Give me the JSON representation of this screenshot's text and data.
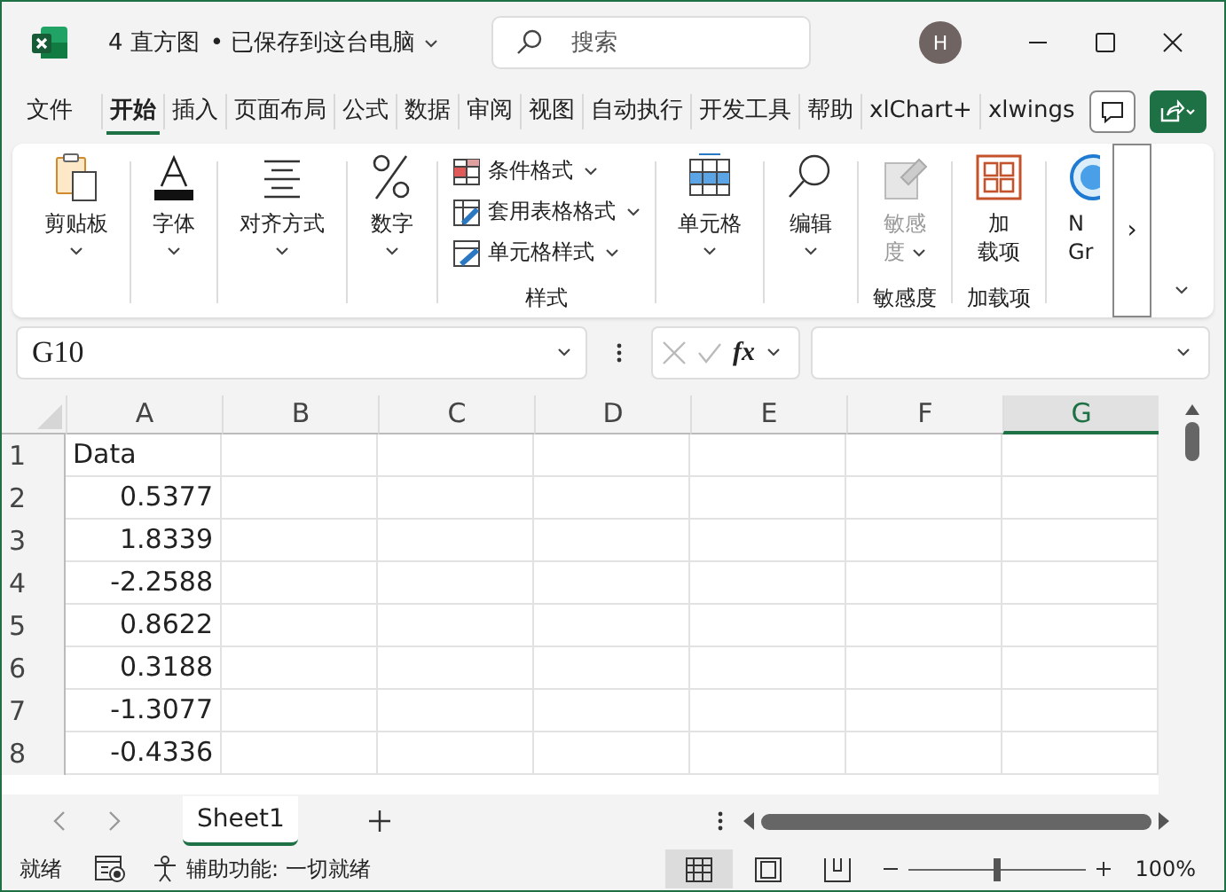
{
  "window": {
    "title": "4 直方图",
    "save_state": "• 已保存到这台电脑",
    "search": {
      "placeholder": "搜索"
    },
    "avatar": "H"
  },
  "tabs": [
    {
      "label": "文件",
      "selected": false
    },
    {
      "label": "开始",
      "selected": true
    },
    {
      "label": "插入",
      "selected": false
    },
    {
      "label": "页面布局",
      "selected": false
    },
    {
      "label": "公式",
      "selected": false
    },
    {
      "label": "数据",
      "selected": false
    },
    {
      "label": "审阅",
      "selected": false
    },
    {
      "label": "视图",
      "selected": false
    },
    {
      "label": "自动执行",
      "selected": false
    },
    {
      "label": "开发工具",
      "selected": false
    },
    {
      "label": "帮助",
      "selected": false
    },
    {
      "label": "xlChart+",
      "selected": false
    },
    {
      "label": "xlwings",
      "selected": false
    }
  ],
  "ribbon": {
    "groups": [
      {
        "kind": "big",
        "buttons": [
          {
            "lines": [
              "剪贴板"
            ],
            "disabled": false,
            "dropdown": true
          }
        ]
      },
      {
        "kind": "big",
        "buttons": [
          {
            "lines": [
              "字体"
            ],
            "disabled": false,
            "dropdown": true
          }
        ]
      },
      {
        "kind": "big",
        "buttons": [
          {
            "lines": [
              "对齐方式"
            ],
            "disabled": false,
            "dropdown": true
          }
        ]
      },
      {
        "kind": "big",
        "buttons": [
          {
            "lines": [
              "数字"
            ],
            "disabled": false,
            "dropdown": true
          }
        ]
      },
      {
        "kind": "list",
        "label": "样式",
        "items": [
          {
            "label": "条件格式"
          },
          {
            "label": "套用表格格式"
          },
          {
            "label": "单元格样式"
          }
        ]
      },
      {
        "kind": "big",
        "buttons": [
          {
            "lines": [
              "单元格"
            ],
            "disabled": false,
            "dropdown": true
          }
        ]
      },
      {
        "kind": "big",
        "buttons": [
          {
            "lines": [
              "编辑"
            ],
            "disabled": false,
            "dropdown": true
          }
        ]
      },
      {
        "kind": "big",
        "label": "敏感度",
        "buttons": [
          {
            "lines": [
              "敏感",
              "度"
            ],
            "disabled": true,
            "dropdown": true
          }
        ]
      },
      {
        "kind": "big",
        "label": "加载项",
        "buttons": [
          {
            "lines": [
              "加",
              "载项"
            ],
            "disabled": false,
            "dropdown": false
          }
        ]
      },
      {
        "kind": "big",
        "buttons": [
          {
            "lines": [
              "N",
              "Gr"
            ],
            "disabled": false,
            "dropdown": false
          }
        ]
      }
    ],
    "more": "›"
  },
  "formula_bar": {
    "name_box": "G10",
    "fx": "fx"
  },
  "sheet": {
    "columns": [
      {
        "label": "A",
        "selected": false
      },
      {
        "label": "B",
        "selected": false
      },
      {
        "label": "C",
        "selected": false
      },
      {
        "label": "D",
        "selected": false
      },
      {
        "label": "E",
        "selected": false
      },
      {
        "label": "F",
        "selected": false
      },
      {
        "label": "G",
        "selected": true
      }
    ],
    "rows": [
      {
        "number": "1",
        "cells": [
          "Data"
        ]
      },
      {
        "number": "2",
        "cells": [
          "0.5377"
        ]
      },
      {
        "number": "3",
        "cells": [
          "1.8339"
        ]
      },
      {
        "number": "4",
        "cells": [
          "-2.2588"
        ]
      },
      {
        "number": "5",
        "cells": [
          "0.8622"
        ]
      },
      {
        "number": "6",
        "cells": [
          "0.3188"
        ]
      },
      {
        "number": "7",
        "cells": [
          "-1.3077"
        ]
      },
      {
        "number": "8",
        "cells": [
          "-0.4336"
        ]
      }
    ]
  },
  "sheet_tabs": [
    {
      "label": "Sheet1",
      "selected": true
    }
  ],
  "status_bar": {
    "ready": "就绪",
    "accessibility": "辅助功能: 一切就绪",
    "views": [
      {
        "kind": "normal",
        "selected": true
      },
      {
        "kind": "layout",
        "selected": false
      },
      {
        "kind": "pagebreak",
        "selected": false
      }
    ],
    "zoom": {
      "level": 0.5,
      "label": "100%"
    }
  }
}
